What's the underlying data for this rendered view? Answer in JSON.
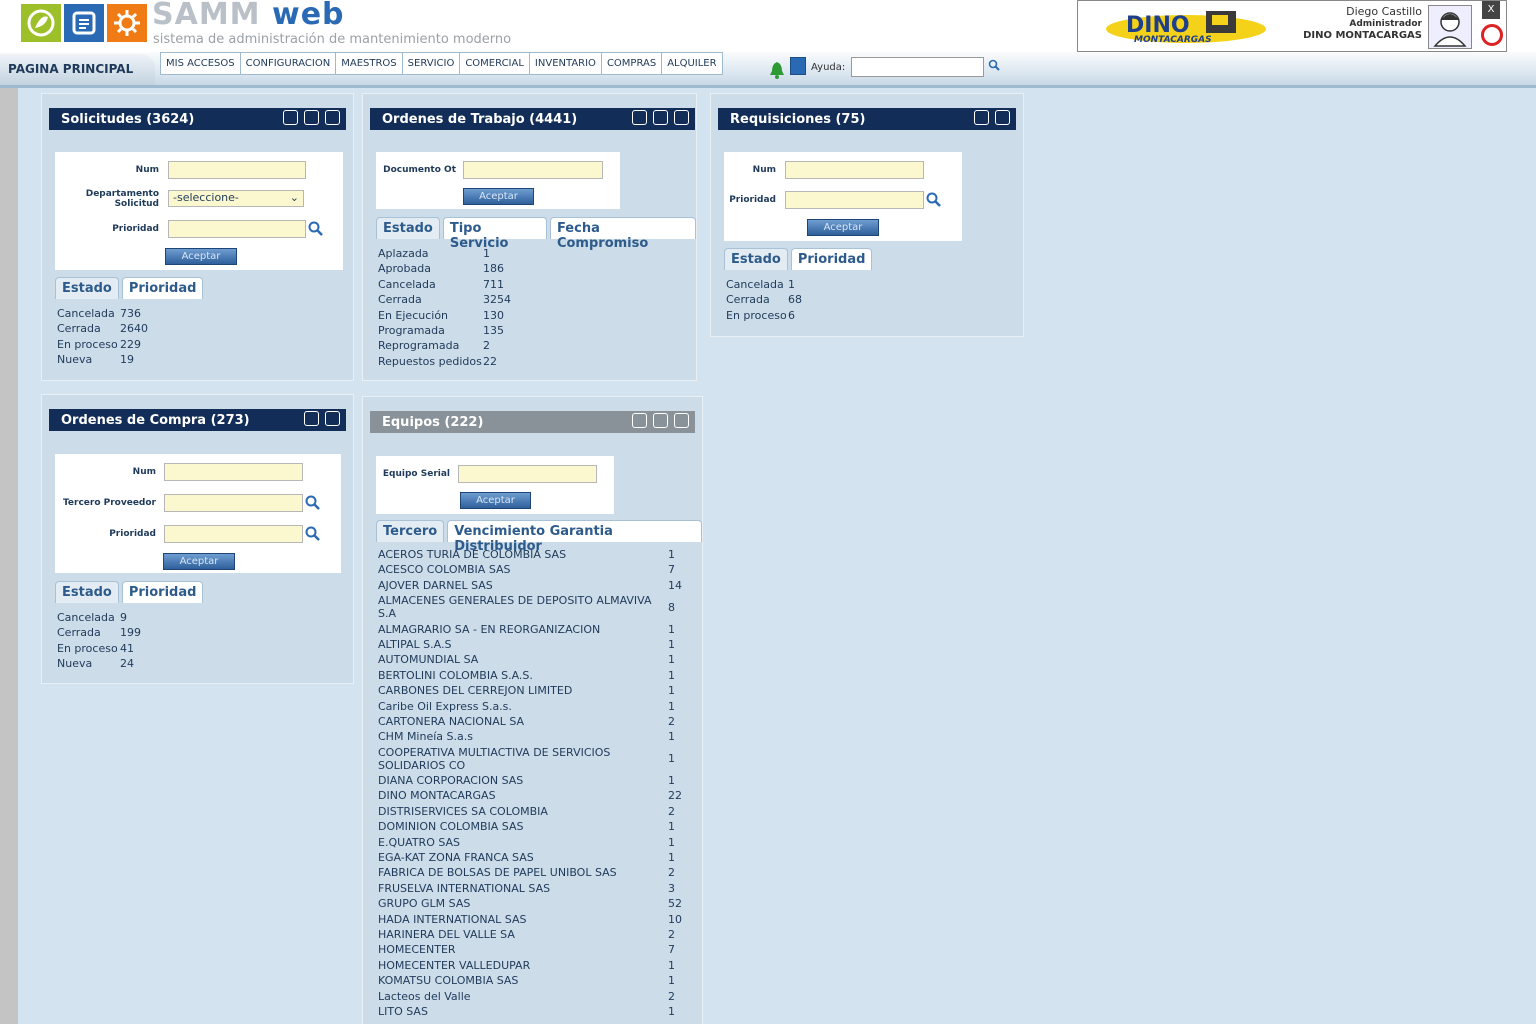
{
  "header": {
    "brand_part1": "SAMM",
    "brand_part2": "web",
    "tagline": "sistema de administración de mantenimiento moderno",
    "user_name": "Diego Castillo",
    "user_role": "Administrador",
    "company": "DINO MONTACARGAS",
    "partner_logo_text1": "DINO",
    "partner_logo_text2": "MONTACARGAS",
    "close_label": "X"
  },
  "nav": {
    "home": "PAGINA PRINCIPAL",
    "menu": [
      "MIS ACCESOS",
      "CONFIGURACION",
      "MAESTROS",
      "SERVICIO",
      "COMERCIAL",
      "INVENTARIO",
      "COMPRAS",
      "ALQUILER"
    ],
    "help_label": "Ayuda:",
    "help_value": ""
  },
  "solicitudes": {
    "title": "Solicitudes (3624)",
    "num_label": "Num",
    "depto_label": "Departamento Solicitud",
    "depto_value": "-seleccione-",
    "prioridad_label": "Prioridad",
    "button": "Aceptar",
    "tabs": [
      "Estado",
      "Prioridad"
    ],
    "stats": [
      {
        "k": "Cancelada",
        "v": "736"
      },
      {
        "k": "Cerrada",
        "v": "2640"
      },
      {
        "k": "En proceso",
        "v": "229"
      },
      {
        "k": "Nueva",
        "v": "19"
      }
    ]
  },
  "ordenes_trabajo": {
    "title": "Ordenes de Trabajo (4441)",
    "doc_label": "Documento Ot",
    "button": "Aceptar",
    "tabs": [
      "Estado",
      "Tipo Servicio",
      "Fecha Compromiso"
    ],
    "stats": [
      {
        "k": "Aplazada",
        "v": "1"
      },
      {
        "k": "Aprobada",
        "v": "186"
      },
      {
        "k": "Cancelada",
        "v": "711"
      },
      {
        "k": "Cerrada",
        "v": "3254"
      },
      {
        "k": "En Ejecución",
        "v": "130"
      },
      {
        "k": "Programada",
        "v": "135"
      },
      {
        "k": "Reprogramada",
        "v": "2"
      },
      {
        "k": "Repuestos pedidos",
        "v": "22"
      }
    ]
  },
  "requisiciones": {
    "title": "Requisiciones (75)",
    "num_label": "Num",
    "prioridad_label": "Prioridad",
    "button": "Aceptar",
    "tabs": [
      "Estado",
      "Prioridad"
    ],
    "stats": [
      {
        "k": "Cancelada",
        "v": "1"
      },
      {
        "k": "Cerrada",
        "v": "68"
      },
      {
        "k": "En proceso",
        "v": "6"
      }
    ]
  },
  "ordenes_compra": {
    "title": "Ordenes de Compra (273)",
    "num_label": "Num",
    "tercero_label": "Tercero Proveedor",
    "prioridad_label": "Prioridad",
    "button": "Aceptar",
    "tabs": [
      "Estado",
      "Prioridad"
    ],
    "stats": [
      {
        "k": "Cancelada",
        "v": "9"
      },
      {
        "k": "Cerrada",
        "v": "199"
      },
      {
        "k": "En proceso",
        "v": "41"
      },
      {
        "k": "Nueva",
        "v": "24"
      }
    ]
  },
  "equipos": {
    "title": "Equipos (222)",
    "serial_label": "Equipo Serial",
    "button": "Aceptar",
    "tabs": [
      "Tercero",
      "Vencimiento Garantia Distribuidor"
    ],
    "rows": [
      {
        "n": "ACEROS TURIA DE COLOMBIA SAS",
        "c": "1"
      },
      {
        "n": "ACESCO COLOMBIA SAS",
        "c": "7"
      },
      {
        "n": "AJOVER DARNEL SAS",
        "c": "14"
      },
      {
        "n": "ALMACENES GENERALES DE DEPOSITO ALMAVIVA S.A",
        "c": "8"
      },
      {
        "n": "ALMAGRARIO SA - EN REORGANIZACION",
        "c": "1"
      },
      {
        "n": "ALTIPAL S.A.S",
        "c": "1"
      },
      {
        "n": "AUTOMUNDIAL SA",
        "c": "1"
      },
      {
        "n": "BERTOLINI COLOMBIA S.A.S.",
        "c": "1"
      },
      {
        "n": "CARBONES DEL CERREJON LIMITED",
        "c": "1"
      },
      {
        "n": "Caribe Oil Express S.a.s.",
        "c": "1"
      },
      {
        "n": "CARTONERA NACIONAL SA",
        "c": "2"
      },
      {
        "n": "CHM Mineía S.a.s",
        "c": "1"
      },
      {
        "n": "COOPERATIVA MULTIACTIVA DE SERVICIOS SOLIDARIOS CO",
        "c": "1"
      },
      {
        "n": "DIANA CORPORACION SAS",
        "c": "1"
      },
      {
        "n": "DINO MONTACARGAS",
        "c": "22"
      },
      {
        "n": "DISTRISERVICES SA COLOMBIA",
        "c": "2"
      },
      {
        "n": "DOMINION COLOMBIA SAS",
        "c": "1"
      },
      {
        "n": "E.QUATRO SAS",
        "c": "1"
      },
      {
        "n": "EGA-KAT ZONA FRANCA SAS",
        "c": "1"
      },
      {
        "n": "FABRICA DE BOLSAS DE PAPEL UNIBOL SAS",
        "c": "2"
      },
      {
        "n": "FRUSELVA INTERNATIONAL SAS",
        "c": "3"
      },
      {
        "n": "GRUPO GLM SAS",
        "c": "52"
      },
      {
        "n": "HADA INTERNATIONAL SAS",
        "c": "10"
      },
      {
        "n": "HARINERA DEL VALLE SA",
        "c": "2"
      },
      {
        "n": "HOMECENTER",
        "c": "7"
      },
      {
        "n": "HOMECENTER VALLEDUPAR",
        "c": "1"
      },
      {
        "n": "KOMATSU COLOMBIA SAS",
        "c": "1"
      },
      {
        "n": "Lacteos del Valle",
        "c": "2"
      },
      {
        "n": "LITO SAS",
        "c": "1"
      }
    ]
  }
}
